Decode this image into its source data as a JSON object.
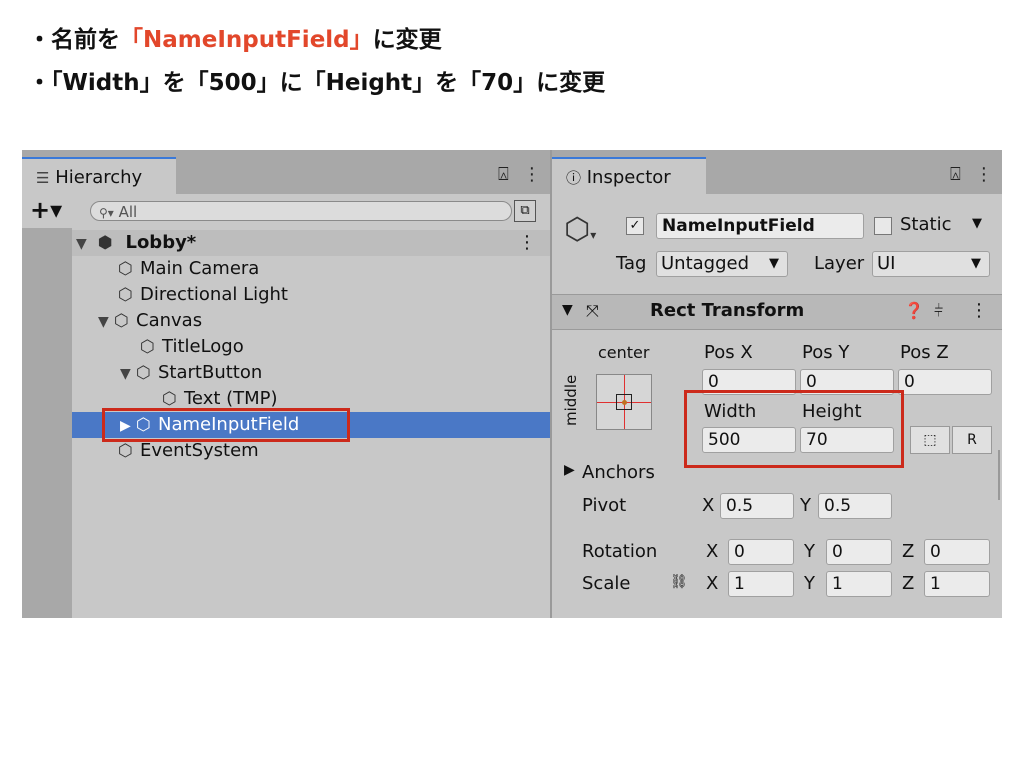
{
  "instructions": {
    "line1": {
      "bullet": "・",
      "prefix": "名前を",
      "highlight": "「NameInputField」",
      "suffix": "に変更"
    },
    "line2": {
      "text": "・「Width」を「500」に「Height」を「70」に変更"
    },
    "highlight_color": "#e2472b"
  },
  "hierarchy": {
    "tab_label": "Hierarchy",
    "tab_icon": "list-icon",
    "lock_icon": "lock-icon",
    "menu_icon": "kebab-icon",
    "add_button": "+▾",
    "search_placeholder": "All",
    "scene_name": "Lobby*",
    "items": [
      {
        "label": "Main Camera",
        "depth": 1,
        "expander": ""
      },
      {
        "label": "Directional Light",
        "depth": 1,
        "expander": ""
      },
      {
        "label": "Canvas",
        "depth": 1,
        "expander": "▼"
      },
      {
        "label": "TitleLogo",
        "depth": 2,
        "expander": ""
      },
      {
        "label": "StartButton",
        "depth": 2,
        "expander": "▼"
      },
      {
        "label": "Text (TMP)",
        "depth": 3,
        "expander": ""
      },
      {
        "label": "NameInputField",
        "depth": 2,
        "expander": "▶",
        "selected": true
      },
      {
        "label": "EventSystem",
        "depth": 1,
        "expander": ""
      }
    ],
    "selection_color": "#4a78c6"
  },
  "inspector": {
    "tab_label": "Inspector",
    "tab_icon": "info-icon",
    "object_name": "NameInputField",
    "active_checked": true,
    "static_label": "Static",
    "tag_label": "Tag",
    "tag_value": "Untagged",
    "layer_label": "Layer",
    "layer_value": "UI",
    "component_title": "Rect Transform",
    "anchor_h": "center",
    "anchor_v": "middle",
    "pos_x_label": "Pos X",
    "pos_y_label": "Pos Y",
    "pos_z_label": "Pos Z",
    "pos_x": "0",
    "pos_y": "0",
    "pos_z": "0",
    "width_label": "Width",
    "height_label": "Height",
    "width": "500",
    "height": "70",
    "blueprint_button": "⬚",
    "raw_button": "R",
    "anchors_label": "Anchors",
    "pivot_label": "Pivot",
    "pivot_x": "0.5",
    "pivot_y": "0.5",
    "rotation_label": "Rotation",
    "rot_x": "0",
    "rot_y": "0",
    "rot_z": "0",
    "scale_label": "Scale",
    "scale_x": "1",
    "scale_y": "1",
    "scale_z": "1",
    "axis_x": "X",
    "axis_y": "Y",
    "axis_z": "Z"
  },
  "annotation_color": "#cc2a1b"
}
